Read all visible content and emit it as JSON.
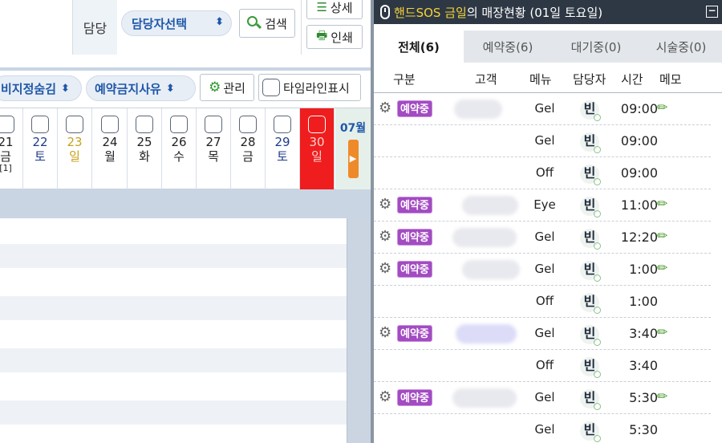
{
  "left": {
    "staff_label": "담당",
    "staff_select": "담당자선택",
    "search_label": "검색",
    "detail_label": "상세",
    "print_label": "인쇄",
    "filter_hide": "비지정숨김",
    "filter_block_reason": "예약금지사유",
    "manage_label": "관리",
    "timeline_label": "타임라인표시",
    "days": [
      {
        "num": "21",
        "wd": "금",
        "extra": "[1]",
        "color": "#222222"
      },
      {
        "num": "22",
        "wd": "토",
        "extra": "",
        "color": "#1f3c8c"
      },
      {
        "num": "23",
        "wd": "일",
        "extra": "",
        "color": "#c7a21d"
      },
      {
        "num": "24",
        "wd": "월",
        "extra": "",
        "color": "#222222"
      },
      {
        "num": "25",
        "wd": "화",
        "extra": "",
        "color": "#222222"
      },
      {
        "num": "26",
        "wd": "수",
        "extra": "",
        "color": "#222222"
      },
      {
        "num": "27",
        "wd": "목",
        "extra": "",
        "color": "#222222"
      },
      {
        "num": "28",
        "wd": "금",
        "extra": "",
        "color": "#222222"
      },
      {
        "num": "29",
        "wd": "토",
        "extra": "",
        "color": "#1f3c8c"
      },
      {
        "num": "30",
        "wd": "일",
        "extra": "",
        "color": "#ffd1d1",
        "today": true
      }
    ],
    "next_month": "07월"
  },
  "right": {
    "title_brand": "핸드SOS 금일",
    "title_rest": "의 매장현황 (01일 토요일)",
    "tabs": [
      {
        "label": "전체(6)",
        "active": true
      },
      {
        "label": "예약중(6)",
        "active": false
      },
      {
        "label": "대기중(0)",
        "active": false
      },
      {
        "label": "시술중(0)",
        "active": false
      }
    ],
    "columns": {
      "type": "구분",
      "customer": "고객",
      "menu": "메뉴",
      "staff": "담당자",
      "time": "시간",
      "memo": "메모"
    },
    "rows": [
      {
        "badge": "예약중",
        "menu": "Gel",
        "staff": "빈",
        "time": "09:00",
        "memo": true
      },
      {
        "badge": "",
        "menu": "Gel",
        "staff": "빈",
        "time": "09:00",
        "memo": false
      },
      {
        "badge": "",
        "menu": "Off",
        "staff": "빈",
        "time": "09:00",
        "memo": false
      },
      {
        "badge": "예약중",
        "menu": "Eye",
        "staff": "빈",
        "time": "11:00",
        "memo": true
      },
      {
        "badge": "예약중",
        "menu": "Gel",
        "staff": "빈",
        "time": "12:20",
        "memo": true
      },
      {
        "badge": "예약중",
        "menu": "Gel",
        "staff": "빈",
        "time": "1:00",
        "memo": true
      },
      {
        "badge": "",
        "menu": "Off",
        "staff": "빈",
        "time": "1:00",
        "memo": false
      },
      {
        "badge": "예약중",
        "menu": "Gel",
        "staff": "빈",
        "time": "3:40",
        "memo": true
      },
      {
        "badge": "",
        "menu": "Off",
        "staff": "빈",
        "time": "3:40",
        "memo": false
      },
      {
        "badge": "예약중",
        "menu": "Gel",
        "staff": "빈",
        "time": "5:30",
        "memo": true
      },
      {
        "badge": "",
        "menu": "Gel",
        "staff": "빈",
        "time": "5:30",
        "memo": false
      }
    ]
  }
}
